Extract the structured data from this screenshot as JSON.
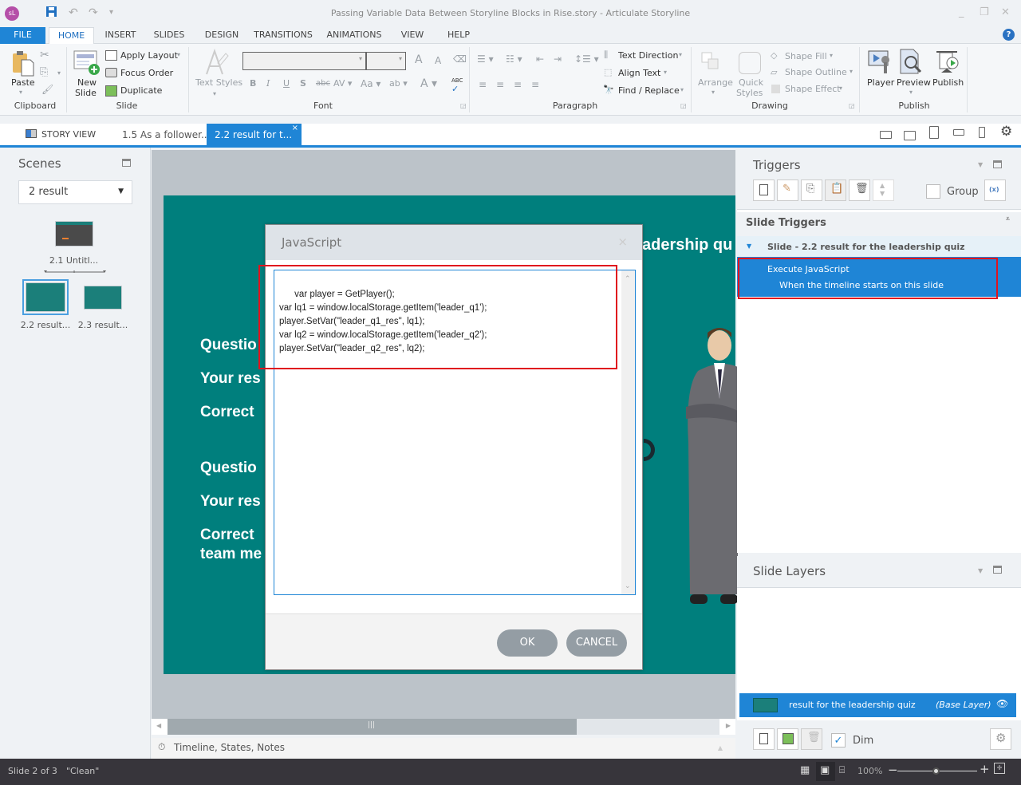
{
  "window": {
    "title": "Passing Variable Data Between Storyline Blocks in Rise.story -  Articulate Storyline",
    "app_logo": "sL",
    "quick_access": [
      "save-icon",
      "undo-icon",
      "redo-icon",
      "customize-icon"
    ]
  },
  "ribbon_tabs": [
    "FILE",
    "HOME",
    "INSERT",
    "SLIDES",
    "DESIGN",
    "TRANSITIONS",
    "ANIMATIONS",
    "VIEW",
    "HELP"
  ],
  "active_ribbon_tab": "HOME",
  "ribbon": {
    "clipboard": {
      "label": "Clipboard",
      "paste": "Paste"
    },
    "slide": {
      "label": "Slide",
      "new_slide": "New",
      "new_slide2": "Slide",
      "apply_layout": "Apply Layout",
      "focus_order": "Focus Order",
      "duplicate": "Duplicate"
    },
    "text_styles": "Text Styles",
    "font": {
      "label": "Font",
      "font_value": "",
      "size_value": ""
    },
    "paragraph": {
      "label": "Paragraph",
      "text_direction": "Text Direction",
      "align_text": "Align Text",
      "find_replace": "Find / Replace"
    },
    "drawing": {
      "label": "Drawing",
      "arrange": "Arrange",
      "quick_styles": "Quick",
      "quick_styles2": "Styles",
      "shape_fill": "Shape Fill",
      "shape_outline": "Shape Outline",
      "shape_effect": "Shape Effect"
    },
    "publish": {
      "label": "Publish",
      "player": "Player",
      "preview": "Preview",
      "publish": "Publish"
    }
  },
  "doc_tabs": {
    "story_view": "STORY VIEW",
    "tab1": "1.5 As a follower...",
    "tab2": "2.2 result for t...",
    "close": "×"
  },
  "scenes": {
    "title": "Scenes",
    "selected_scene": "2 result",
    "slides": [
      {
        "label": "2.1 Untitl...",
        "selected": false
      },
      {
        "label": "2.2 result...",
        "selected": true
      },
      {
        "label": "2.3 result...",
        "selected": false
      }
    ]
  },
  "slide": {
    "title_fragment": "adership qu",
    "lines": [
      "Questio",
      "Your res",
      "Correct",
      "Questio",
      "Your res",
      "Correct",
      "team me"
    ]
  },
  "dialog": {
    "title": "JavaScript",
    "close": "×",
    "code": "var player = GetPlayer();\nvar lq1 = window.localStorage.getItem('leader_q1');\nplayer.SetVar(\"leader_q1_res\", lq1);\nvar lq2 = window.localStorage.getItem('leader_q2');\nplayer.SetVar(\"leader_q2_res\", lq2);",
    "ok": "OK",
    "cancel": "CANCEL"
  },
  "triggers": {
    "title": "Triggers",
    "group_label": "Group",
    "group_checked": false,
    "section": "Slide Triggers",
    "slide_row": "Slide - 2.2 result for the leadership quiz",
    "item_action": "Execute JavaScript",
    "item_condition": "When the timeline starts on this slide"
  },
  "layers": {
    "title": "Slide Layers",
    "base_layer_name": "result for the leadership quiz",
    "base_layer_tag": "(Base Layer)",
    "dim_label": "Dim",
    "dim_checked": true
  },
  "bottom": {
    "timeline_label": "Timeline, States, Notes"
  },
  "status": {
    "slide_info": "Slide 2 of 3",
    "theme": "\"Clean\"",
    "zoom": "100%",
    "zoom_fraction": 0.5
  },
  "colors": {
    "accent": "#1f85d6",
    "slide_bg": "#007f7d",
    "highlight_box": "#e0141e",
    "status_bg": "#37353b"
  }
}
